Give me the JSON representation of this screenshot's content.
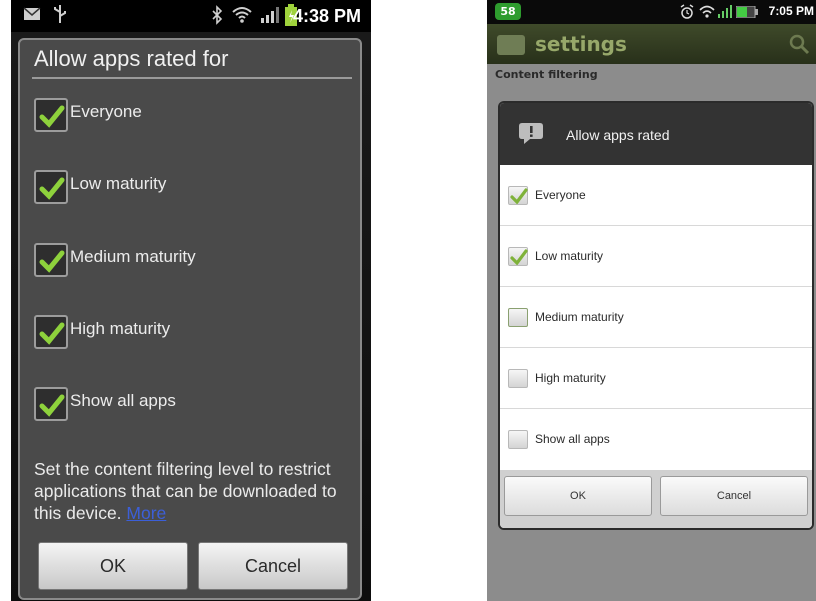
{
  "left": {
    "status": {
      "time": "4:38 PM",
      "icons": [
        "mail-icon",
        "usb-icon",
        "bluetooth-icon",
        "wifi-icon",
        "signal-icon",
        "battery-icon"
      ]
    },
    "dialog": {
      "title": "Allow apps rated for",
      "options": [
        {
          "label": "Everyone",
          "checked": true
        },
        {
          "label": "Low maturity",
          "checked": true
        },
        {
          "label": "Medium maturity",
          "checked": true
        },
        {
          "label": "High maturity",
          "checked": true
        },
        {
          "label": "Show all apps",
          "checked": true
        }
      ],
      "description": "Set the content filtering level to restrict applications that can be downloaded to this device.",
      "more_link": "More",
      "ok_label": "OK",
      "cancel_label": "Cancel"
    }
  },
  "right": {
    "status": {
      "badge": "58",
      "time": "7:05 PM",
      "icons": [
        "alarm-icon",
        "wifi-icon",
        "signal-icon",
        "battery-icon"
      ]
    },
    "appbar": {
      "title": "settings"
    },
    "section": "Content filtering",
    "dialog": {
      "title": "Allow apps rated",
      "options": [
        {
          "label": "Everyone",
          "checked": true
        },
        {
          "label": "Low maturity",
          "checked": true
        },
        {
          "label": "Medium maturity",
          "checked": false
        },
        {
          "label": "High maturity",
          "checked": false
        },
        {
          "label": "Show all apps",
          "checked": false
        }
      ],
      "ok_label": "OK",
      "cancel_label": "Cancel"
    }
  },
  "colors": {
    "check_green": "#8ed23c",
    "link_blue": "#3c5fd8",
    "appbar_olive": "#3f4a2a"
  }
}
